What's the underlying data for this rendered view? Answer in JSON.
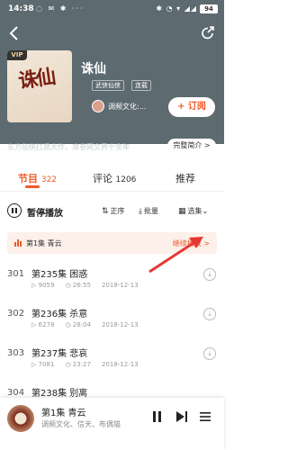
{
  "status": {
    "time": "14:38",
    "battery": "94"
  },
  "book": {
    "cover_title": "诛仙",
    "vip": "VIP",
    "title": "诛仙",
    "tags": [
      "武侠仙侠",
      "连载"
    ],
    "author": "调频文化:...",
    "subscribe": "+ 订阅",
    "description": "东方仙侠扛鼎大作，席卷网文界十余年",
    "full_intro": "完整简介 >"
  },
  "tabs": [
    {
      "label": "节目",
      "count": "322"
    },
    {
      "label": "评论",
      "count": "1206"
    },
    {
      "label": "推荐",
      "count": ""
    }
  ],
  "controls": {
    "pause": "暂停播放",
    "sort": "正序",
    "batch": "批量",
    "select": "选集"
  },
  "last_played": {
    "text": "第1集 青云",
    "continue": "继续播放 >"
  },
  "episodes": [
    {
      "num": "301",
      "title": "第235集 困惑",
      "plays": "9059",
      "duration": "26:55",
      "date": "2018-12-13"
    },
    {
      "num": "302",
      "title": "第236集 杀意",
      "plays": "6278",
      "duration": "28:04",
      "date": "2018-12-13"
    },
    {
      "num": "303",
      "title": "第237集 悲哀",
      "plays": "7081",
      "duration": "23:27",
      "date": "2018-12-13"
    },
    {
      "num": "304",
      "title": "第238集 别离",
      "plays": "",
      "duration": "",
      "date": ""
    }
  ],
  "player": {
    "title": "第1集 青云",
    "author": "调频文化、信天、布偶猫"
  },
  "colors": {
    "accent": "#f05a28",
    "header": "#5d6a70"
  }
}
